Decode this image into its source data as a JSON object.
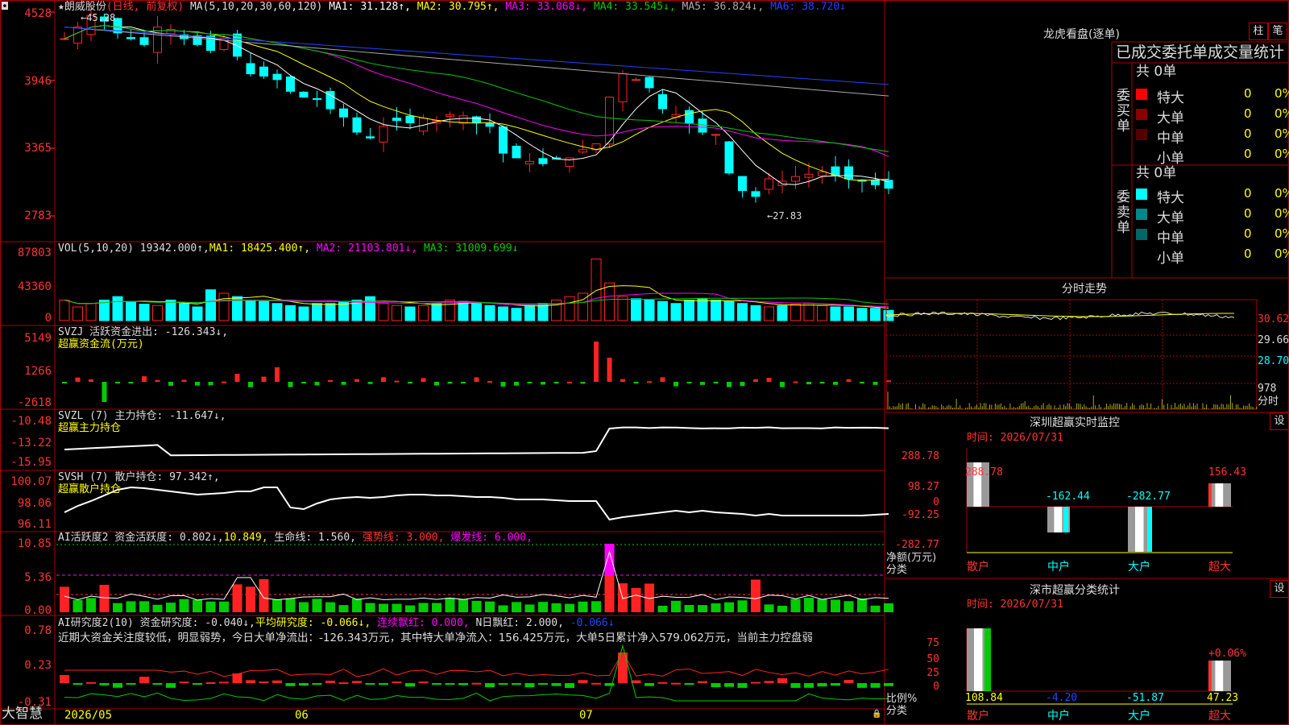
{
  "colors": {
    "up": "#ff2222",
    "down": "#00ffff",
    "ma1": "#ffffff",
    "ma2": "#ffff00",
    "ma3": "#ff00ff",
    "ma4": "#00cc00",
    "ma5": "#aaaaaa",
    "ma6": "#2244ff",
    "grid": "#aa0000"
  },
  "header": {
    "star": "★",
    "stock_name": "朗威股份",
    "period": "(日线, 前复权)",
    "ma_params": "MA(5,10,20,30,60,120)",
    "ma1": "MA1: 31.128↑,",
    "ma2": "MA2: 30.795↑,",
    "ma3": "MA3: 33.068↓,",
    "ma4": "MA4: 33.545↓,",
    "ma5": "MA5: 36.824↓,",
    "ma6": "MA6: 38.720↓"
  },
  "main_axis": [
    "4528",
    "3946",
    "3365",
    "2783"
  ],
  "annotations": {
    "high": "45.28",
    "low": "←27.83",
    "high_arrow": "←"
  },
  "vol": {
    "label": "VOL(5,10,20)",
    "value": "19342.000↑,",
    "ma1": "MA1: 18425.400↑,",
    "ma2": "MA2: 21103.801↓,",
    "ma3": "MA3: 31009.699↓",
    "axis": [
      "87803",
      "43360",
      "0"
    ]
  },
  "svzj": {
    "label": "SVZJ  活跃资金进出: -126.343↓,",
    "sub": "超赢资金流(万元)",
    "axis": [
      "5149",
      "1266",
      "-2618"
    ]
  },
  "svzl": {
    "label": "SVZL  (7) 主力持仓: -11.647↓,",
    "sub": "超赢主力持仓",
    "axis": [
      "-10.48",
      "-13.22",
      "-15.95"
    ]
  },
  "svsh": {
    "label": "SVSH  (7) 散户持仓: 97.342↑,",
    "sub": "超赢散户持仓",
    "axis": [
      "100.07",
      "98.06",
      "96.11"
    ]
  },
  "ai1": {
    "label": "AI活跃度2 资金活跃度: 0.802↓,",
    "v2": "10.849,",
    "v3": "生命线: 1.560,",
    "v4": "强势线: 3.000,",
    "v5": "爆发线: 6.000,",
    "axis": [
      "10.85",
      "5.36",
      "0.00"
    ]
  },
  "ai2": {
    "label": "AI研究度2(10) 资金研究度: -0.040↓,",
    "v2": "平均研究度: -0.066↓,",
    "v3": "连续飘红: 0.000,",
    "v4": "N日飘红: 2.000,",
    "v5": "-0.066↓",
    "comment": "近期大资金关注度较低，明显弱势，今日大单净流出：-126.343万元，其中特大单净流入：156.425万元，大单5日累计净入579.062万元，当前主力控盘弱",
    "axis": [
      "0.78",
      "0.23",
      "-0.31"
    ]
  },
  "bottom": {
    "brand": "大智慧",
    "dates": [
      "2026/05",
      "06",
      "07"
    ]
  },
  "lhb": {
    "title": "龙虎看盘(逐单)",
    "btn1": "柱",
    "btn2": "笔",
    "subtitle": "已成交委托单成交量统计",
    "buy_label": "委买单",
    "buy_total": "共 0单",
    "sell_label": "委卖单",
    "sell_total": "共 0单",
    "buy_rows": [
      {
        "name": "特大",
        "v1": "0",
        "v2": "0%",
        "color": "#ff0000"
      },
      {
        "name": "大单",
        "v1": "0",
        "v2": "0%",
        "color": "#880000"
      },
      {
        "name": "中单",
        "v1": "0",
        "v2": "0%",
        "color": "#550000"
      },
      {
        "name": "小单",
        "v1": "0",
        "v2": "0%",
        "color": "#000000"
      }
    ],
    "sell_rows": [
      {
        "name": "特大",
        "v1": "0",
        "v2": "0%",
        "color": "#00ffff"
      },
      {
        "name": "大单",
        "v1": "0",
        "v2": "0%",
        "color": "#008888"
      },
      {
        "name": "中单",
        "v1": "0",
        "v2": "0%",
        "color": "#006666"
      },
      {
        "name": "小单",
        "v1": "0",
        "v2": "0%",
        "color": "#000000"
      }
    ]
  },
  "intraday": {
    "title": "分时走势",
    "axis": [
      "30.62",
      "29.66",
      "28.70",
      "978",
      "分时"
    ]
  },
  "monitor": {
    "title": "深圳超赢实时监控",
    "btn": "设",
    "time": "时间: 2026/07/31",
    "axis": [
      "288.78",
      "98.27",
      "0",
      "-92.25",
      "-282.77"
    ],
    "ylab": "净额(万元)",
    "xlab": "分类",
    "cats": [
      "散户",
      "中户",
      "大户",
      "超大"
    ],
    "values": [
      "288.78",
      "-162.44",
      "-282.77",
      "156.43"
    ]
  },
  "stats": {
    "title": "深市超赢分类统计",
    "btn": "设",
    "time": "时间: 2026/07/31",
    "axis": [
      "75",
      "50",
      "25",
      "0"
    ],
    "ylab": "比例%",
    "xlab": "分类",
    "cats": [
      "散户",
      "中户",
      "大户",
      "超大"
    ],
    "values": [
      "108.84",
      "-4.20",
      "-51.87",
      "47.23"
    ],
    "top_label": "+0.06%"
  }
}
